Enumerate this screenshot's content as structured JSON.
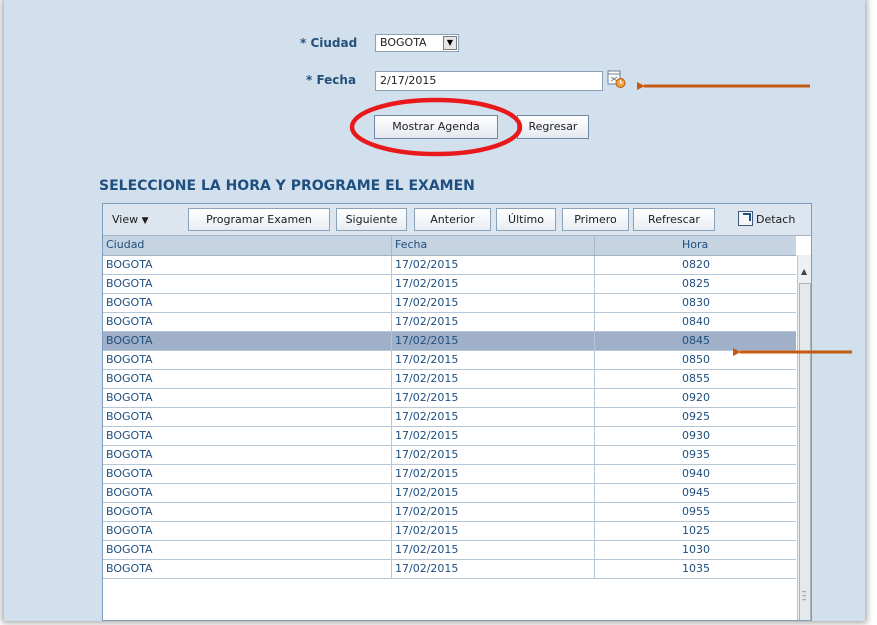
{
  "form": {
    "ciudad_label": "* Ciudad",
    "ciudad_value": "BOGOTA",
    "fecha_label": "* Fecha",
    "fecha_value": "2/17/2015",
    "mostrar_button": "Mostrar Agenda",
    "regresar_button": "Regresar"
  },
  "section_title": "SELECCIONE LA HORA Y PROGRAME EL EXAMEN",
  "toolbar": {
    "view": "View",
    "programar": "Programar Examen",
    "siguiente": "Siguiente",
    "anterior": "Anterior",
    "ultimo": "Último",
    "primero": "Primero",
    "refrescar": "Refrescar",
    "detach": "Detach"
  },
  "table": {
    "headers": [
      "Ciudad",
      "Fecha",
      "Hora"
    ],
    "rows": [
      [
        "BOGOTA",
        "17/02/2015",
        "0820"
      ],
      [
        "BOGOTA",
        "17/02/2015",
        "0825"
      ],
      [
        "BOGOTA",
        "17/02/2015",
        "0830"
      ],
      [
        "BOGOTA",
        "17/02/2015",
        "0840"
      ],
      [
        "BOGOTA",
        "17/02/2015",
        "0845"
      ],
      [
        "BOGOTA",
        "17/02/2015",
        "0850"
      ],
      [
        "BOGOTA",
        "17/02/2015",
        "0855"
      ],
      [
        "BOGOTA",
        "17/02/2015",
        "0920"
      ],
      [
        "BOGOTA",
        "17/02/2015",
        "0925"
      ],
      [
        "BOGOTA",
        "17/02/2015",
        "0930"
      ],
      [
        "BOGOTA",
        "17/02/2015",
        "0935"
      ],
      [
        "BOGOTA",
        "17/02/2015",
        "0940"
      ],
      [
        "BOGOTA",
        "17/02/2015",
        "0945"
      ],
      [
        "BOGOTA",
        "17/02/2015",
        "0955"
      ],
      [
        "BOGOTA",
        "17/02/2015",
        "1025"
      ],
      [
        "BOGOTA",
        "17/02/2015",
        "1030"
      ],
      [
        "BOGOTA",
        "17/02/2015",
        "1035"
      ]
    ],
    "selected_index": 4
  },
  "colors": {
    "annotation_arrow": "#c55a11",
    "annotation_circle": "#e8181b"
  }
}
